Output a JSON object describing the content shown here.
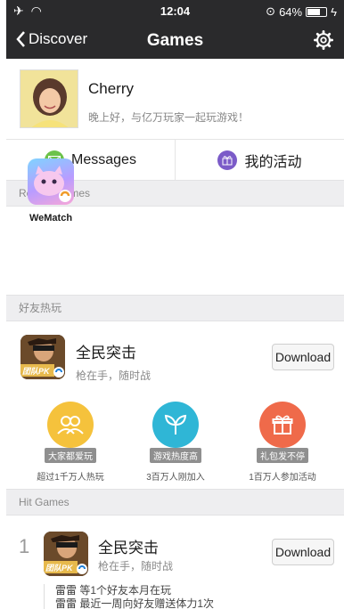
{
  "status": {
    "time": "12:04",
    "battery": "64%"
  },
  "nav": {
    "back_label": "Discover",
    "title": "Games"
  },
  "profile": {
    "name": "Cherry",
    "greeting": "晚上好，与亿万玩家一起玩游戏！"
  },
  "actions": [
    {
      "label": "Messages"
    },
    {
      "label": "我的活动"
    }
  ],
  "sections": {
    "recent": "Recent Games",
    "friends_hot": "好友热玩",
    "hit": "Hit Games"
  },
  "recent_games": [
    {
      "name": "WeMatch"
    }
  ],
  "friends_game": {
    "title": "全民突击",
    "subtitle": "枪在手，随时战",
    "button": "Download",
    "icon_text": "团队PK"
  },
  "features": [
    {
      "tag": "大家都爱玩",
      "desc": "超过1千万人热玩",
      "color": "#f5c23c"
    },
    {
      "tag": "游戏热度高",
      "desc": "3百万人刚加入",
      "color": "#2fb6d6"
    },
    {
      "tag": "礼包发不停",
      "desc": "1百万人参加活动",
      "color": "#ef6a4a"
    }
  ],
  "hit_game": {
    "rank": "1",
    "title": "全民突击",
    "subtitle": "枪在手，随时战",
    "button": "Download",
    "icon_text": "团队PK",
    "activity": [
      {
        "who": "雷雷",
        "text": "等1个好友本月在玩"
      },
      {
        "who": "雷雷",
        "text": "最近一周向好友赠送体力1次"
      }
    ]
  }
}
